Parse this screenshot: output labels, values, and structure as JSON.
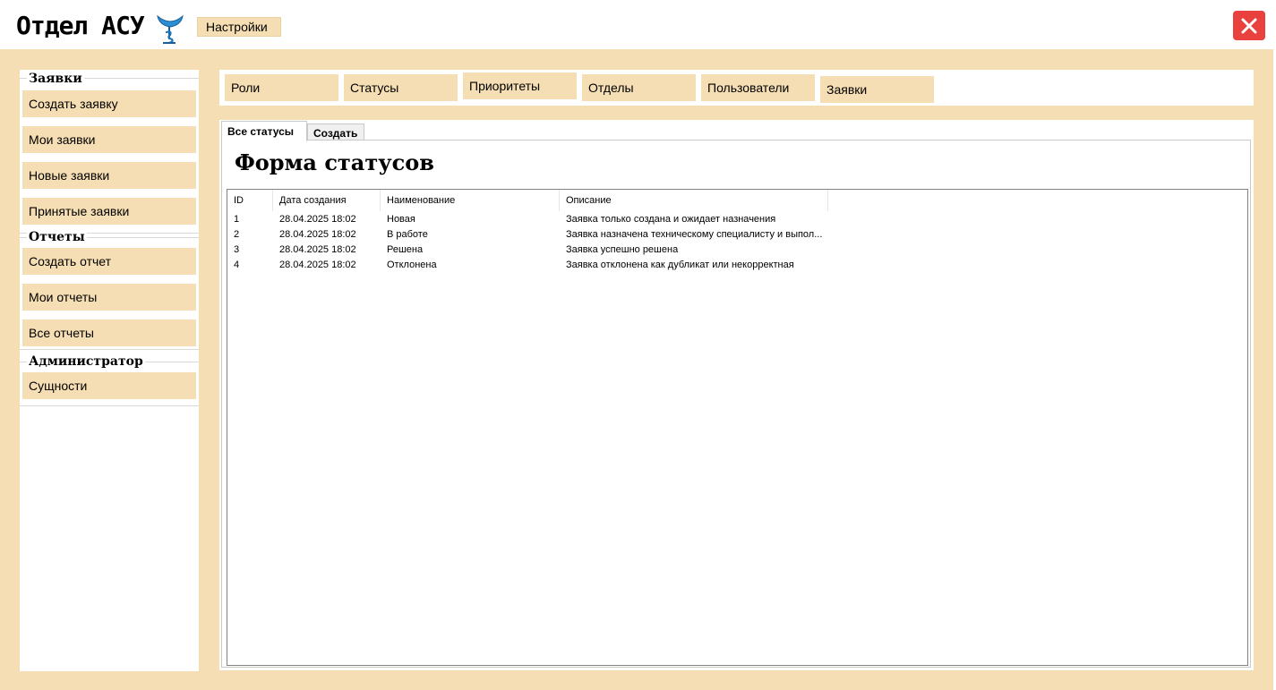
{
  "app": {
    "title": "Отдел АСУ",
    "settings_label": "Настройки",
    "accent": "#f5deb3",
    "close_color": "#e8413e"
  },
  "sidebar": {
    "groups": [
      {
        "label": "Заявки",
        "items": [
          "Создать заявку",
          "Мои заявки",
          "Новые заявки",
          "Принятые заявки"
        ]
      },
      {
        "label": "Отчеты",
        "items": [
          "Создать отчет",
          "Мои отчеты",
          "Все отчеты"
        ]
      },
      {
        "label": "Администратор",
        "items": [
          "Сущности"
        ]
      }
    ]
  },
  "nav": {
    "items": [
      "Роли",
      "Статусы",
      "Приоритеты",
      "Отделы",
      "Пользователи",
      "Заявки"
    ]
  },
  "tabs": {
    "active": "Все статусы",
    "create": "Создать"
  },
  "form": {
    "title": "Форма статусов"
  },
  "table": {
    "columns": [
      "ID",
      "Дата создания",
      "Наименование",
      "Описание"
    ],
    "rows": [
      [
        "1",
        "28.04.2025 18:02",
        "Новая",
        "Заявка только создана и ожидает назначения"
      ],
      [
        "2",
        "28.04.2025 18:02",
        "В работе",
        "Заявка назначена техническому специалисту и выпол..."
      ],
      [
        "3",
        "28.04.2025 18:02",
        "Решена",
        "Заявка успешно решена"
      ],
      [
        "4",
        "28.04.2025 18:02",
        "Отклонена",
        "Заявка отклонена как дубликат или некорректная"
      ]
    ]
  },
  "icons": {
    "logo": "medical-bowl-snake-icon",
    "close": "close-icon"
  }
}
